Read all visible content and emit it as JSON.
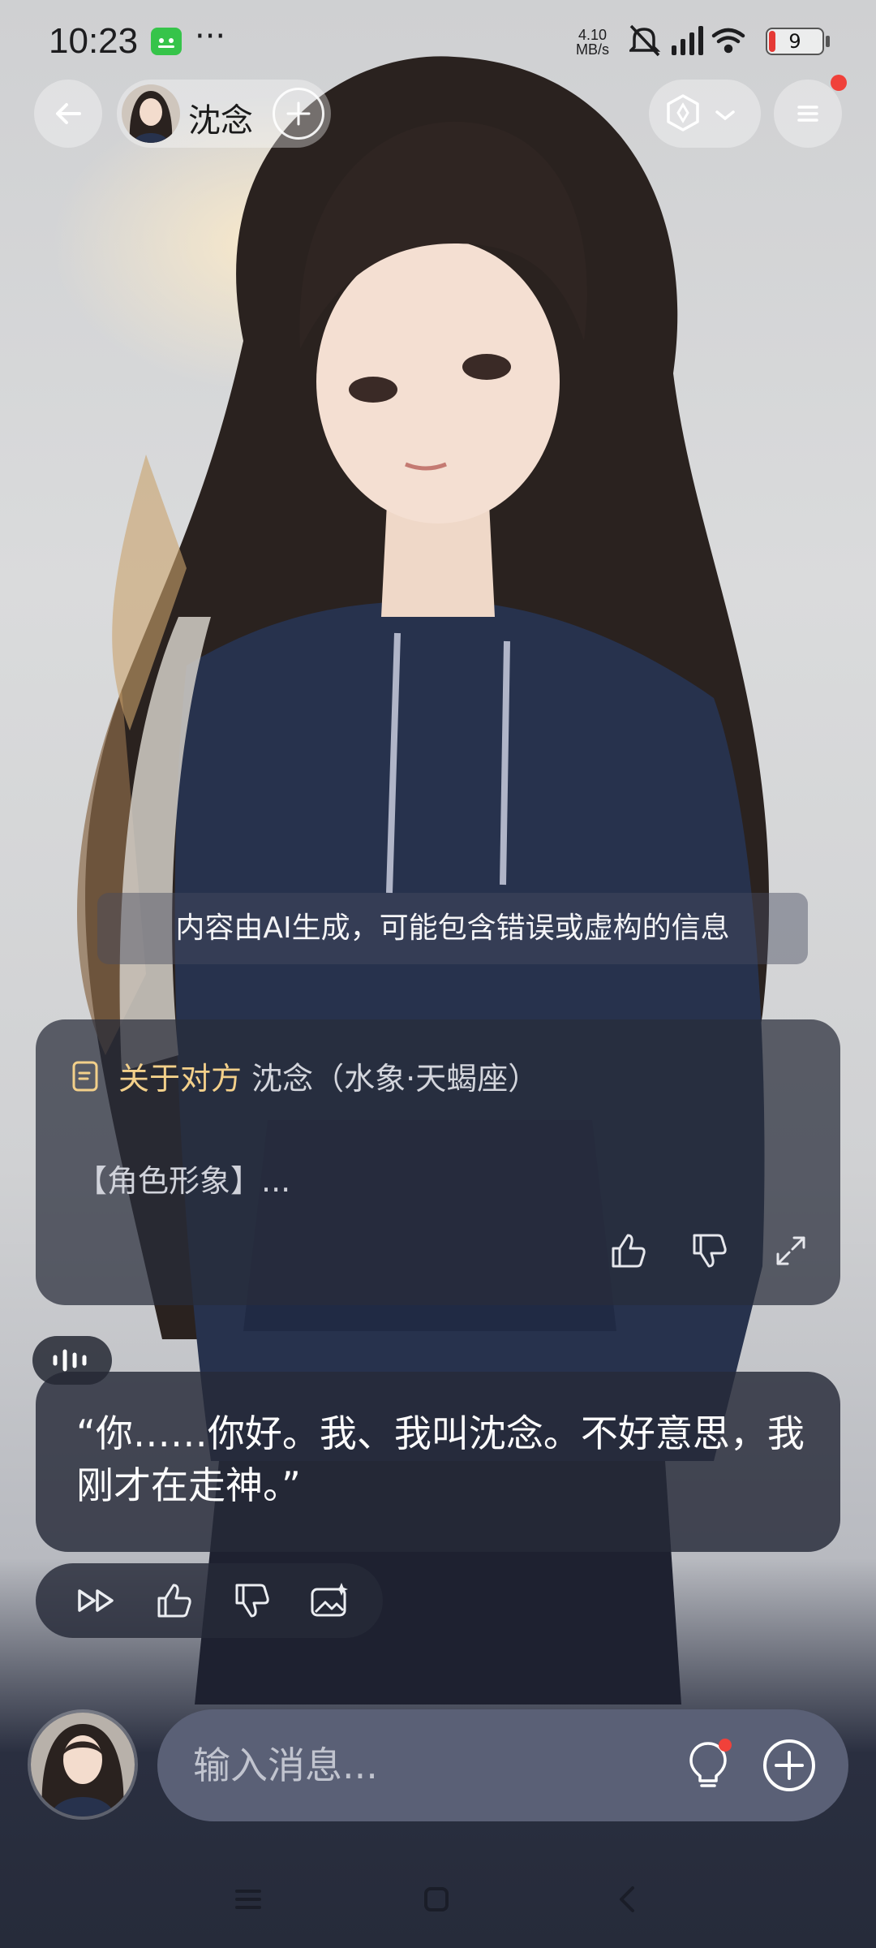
{
  "status_bar": {
    "time": "10:23",
    "dots": "···",
    "net_speed_value": "4.10",
    "net_speed_unit": "MB/s",
    "battery_level": "9",
    "icons": [
      "app-notification-icon",
      "mute-icon",
      "signal-icon",
      "wifi-icon",
      "battery-icon"
    ]
  },
  "header": {
    "character_name": "沈念",
    "icons": [
      "back-arrow-icon",
      "add-icon",
      "mode-icon",
      "chevron-down-icon",
      "menu-icon"
    ],
    "menu_badge_color": "#f0413a"
  },
  "disclaimer": "内容由AI生成，可能包含错误或虚构的信息",
  "about_card": {
    "title_highlight": "关于对方",
    "title_rest": "沈念（水象·天蝎座）",
    "body": "【角色形象】...",
    "accent_color": "#f3d08a",
    "icons": [
      "doc-icon",
      "thumb-up-icon",
      "thumb-down-icon",
      "expand-icon"
    ]
  },
  "message": {
    "text": "“你……你好。我、我叫沈念。不好意思，我刚才在走神。”",
    "action_icons": [
      "fast-forward-icon",
      "thumb-up-icon",
      "thumb-down-icon",
      "image-sparkle-icon"
    ]
  },
  "input": {
    "placeholder": "输入消息...",
    "value": "",
    "icons": [
      "bulb-icon",
      "plus-circle-icon"
    ]
  },
  "nav_bar": {
    "icons": [
      "nav-menu-icon",
      "nav-home-icon",
      "nav-back-icon"
    ]
  }
}
